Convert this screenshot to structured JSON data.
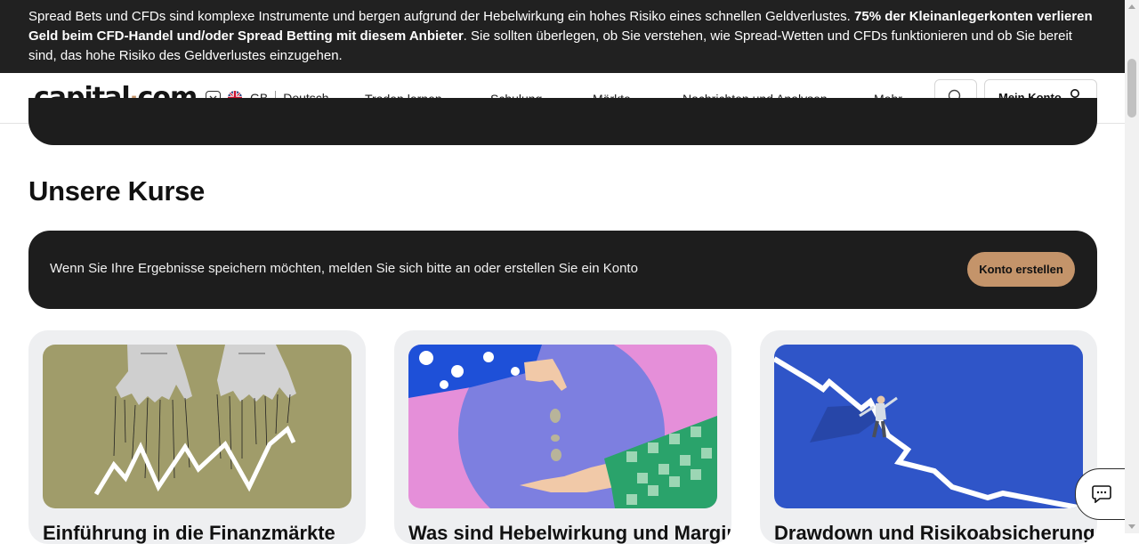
{
  "risk_warning": {
    "text_start": "Spread Bets und CFDs sind komplexe Instrumente und bergen aufgrund der Hebelwirkung ein hohes Risiko eines schnellen Geldverlustes. ",
    "text_bold": "75% der Kleinanlegerkonten verlieren Geld beim CFD-Handel und/oder Spread Betting mit diesem Anbieter",
    "text_end": ". Sie sollten überlegen, ob Sie verstehen, wie Spread-Wetten und CFDs funktionieren und ob Sie bereit sind, das hohe Risiko des Geldverlustes einzugehen."
  },
  "header": {
    "logo_left": "capital",
    "logo_dot": "·",
    "logo_right": "com",
    "region": "GB",
    "language": "Deutsch",
    "nav": [
      {
        "label": "Traden lernen"
      },
      {
        "label": "Schulung"
      },
      {
        "label": "Märkte"
      },
      {
        "label": "Nachrichten und Analysen"
      },
      {
        "label": "Mehr"
      }
    ],
    "account_label": "Mein Konto"
  },
  "section": {
    "title": "Unsere Kurse"
  },
  "login_bar": {
    "text": "Wenn Sie Ihre Ergebnisse speichern möchten, melden Sie sich bitte an oder erstellen Sie ein Konto",
    "button_label": "Konto erstellen"
  },
  "courses": [
    {
      "title": "Einführung in die Finanzmärkte",
      "image": "puppet-hands-chart"
    },
    {
      "title": "Was sind Hebelwirkung und Margin",
      "image": "hands-dropping-coins"
    },
    {
      "title": "Drawdown und Risikoabsicherung",
      "image": "man-balancing-on-falling-line"
    }
  ],
  "colors": {
    "banner_bg": "#212121",
    "accent": "#c4946a",
    "dark_card": "#1d1d1d",
    "card_bg": "#eeeff1"
  }
}
